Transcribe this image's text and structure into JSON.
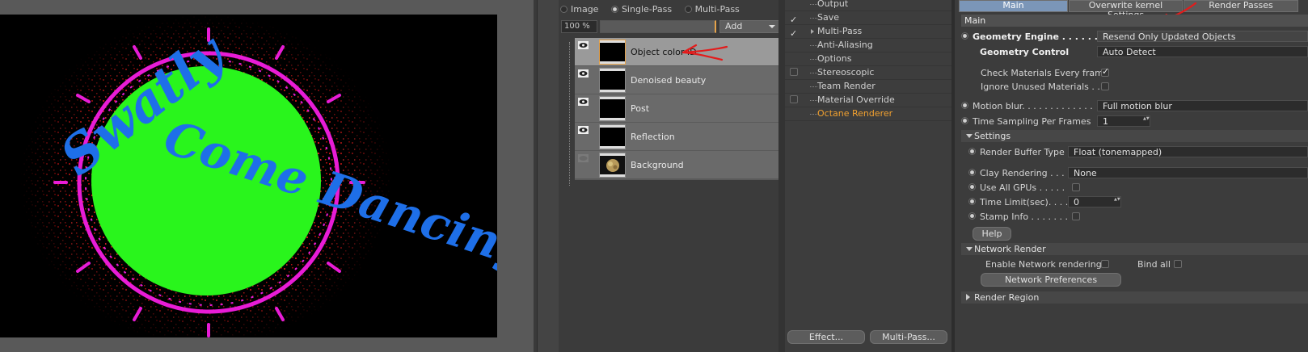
{
  "colors": {
    "accent": "#e5a24a",
    "tab_active": "#7b96b8",
    "annotation": "#e31b1b"
  },
  "render_view": {
    "logo_text_line1": "Swatly",
    "logo_text_line2": "Come Dancing"
  },
  "layers_panel": {
    "modes": [
      {
        "label": "Image",
        "selected": false
      },
      {
        "label": "Single-Pass",
        "selected": true
      },
      {
        "label": "Multi-Pass",
        "selected": false
      }
    ],
    "zoom": "100 %",
    "add_label": "Add",
    "layers": [
      {
        "name": "Object color ID",
        "selected": true,
        "visible": true
      },
      {
        "name": "Denoised beauty",
        "selected": false,
        "visible": true
      },
      {
        "name": "Post",
        "selected": false,
        "visible": true
      },
      {
        "name": "Reflection",
        "selected": false,
        "visible": true
      },
      {
        "name": "Background",
        "selected": false,
        "visible": false
      }
    ]
  },
  "render_list": {
    "items": [
      {
        "label": "Output",
        "check": "none"
      },
      {
        "label": "Save",
        "check": "checked"
      },
      {
        "label": "Multi-Pass",
        "check": "checked"
      },
      {
        "label": "Anti-Aliasing",
        "check": "none"
      },
      {
        "label": "Options",
        "check": "none"
      },
      {
        "label": "Stereoscopic",
        "check": "box"
      },
      {
        "label": "Team Render",
        "check": "none"
      },
      {
        "label": "Material Override",
        "check": "box"
      },
      {
        "label": "Octane Renderer",
        "check": "none",
        "active": true
      }
    ],
    "effect_button": "Effect...",
    "multipass_button": "Multi-Pass..."
  },
  "settings": {
    "tabs": [
      {
        "label": "Main",
        "active": true
      },
      {
        "label": "Overwrite kernel Settings",
        "active": false
      },
      {
        "label": "Render Passes",
        "active": false
      }
    ],
    "main_header": "Main",
    "geometry_engine_label": "Geometry Engine . . . . . . . .",
    "geometry_engine_value": "Resend Only Updated Objects",
    "geometry_control_label": "Geometry Control",
    "geometry_control_value": "Auto Detect",
    "check_materials_label": "Check Materials Every frame",
    "check_materials_checked": true,
    "ignore_unused_label": "Ignore Unused Materials . .",
    "ignore_unused_checked": false,
    "motion_blur_label": "Motion blur. . . . . . . . . . . . .",
    "motion_blur_value": "Full motion blur",
    "time_sampling_label": "Time Sampling Per Frames",
    "time_sampling_value": "1",
    "settings_section": "Settings",
    "render_buffer_label": "Render Buffer Type",
    "render_buffer_value": "Float (tonemapped)",
    "clay_label": "Clay Rendering . . .",
    "clay_value": "None",
    "use_all_gpus_label": "Use All GPUs . . . . .",
    "time_limit_label": "Time Limit(sec). . . .",
    "time_limit_value": "0",
    "stamp_info_label": "Stamp Info . . . . . . .",
    "help_button": "Help",
    "network_section": "Network Render",
    "enable_network_label": "Enable Network rendering",
    "bind_all_label": "Bind all",
    "network_prefs_button": "Network Preferences",
    "render_region_section": "Render Region"
  }
}
